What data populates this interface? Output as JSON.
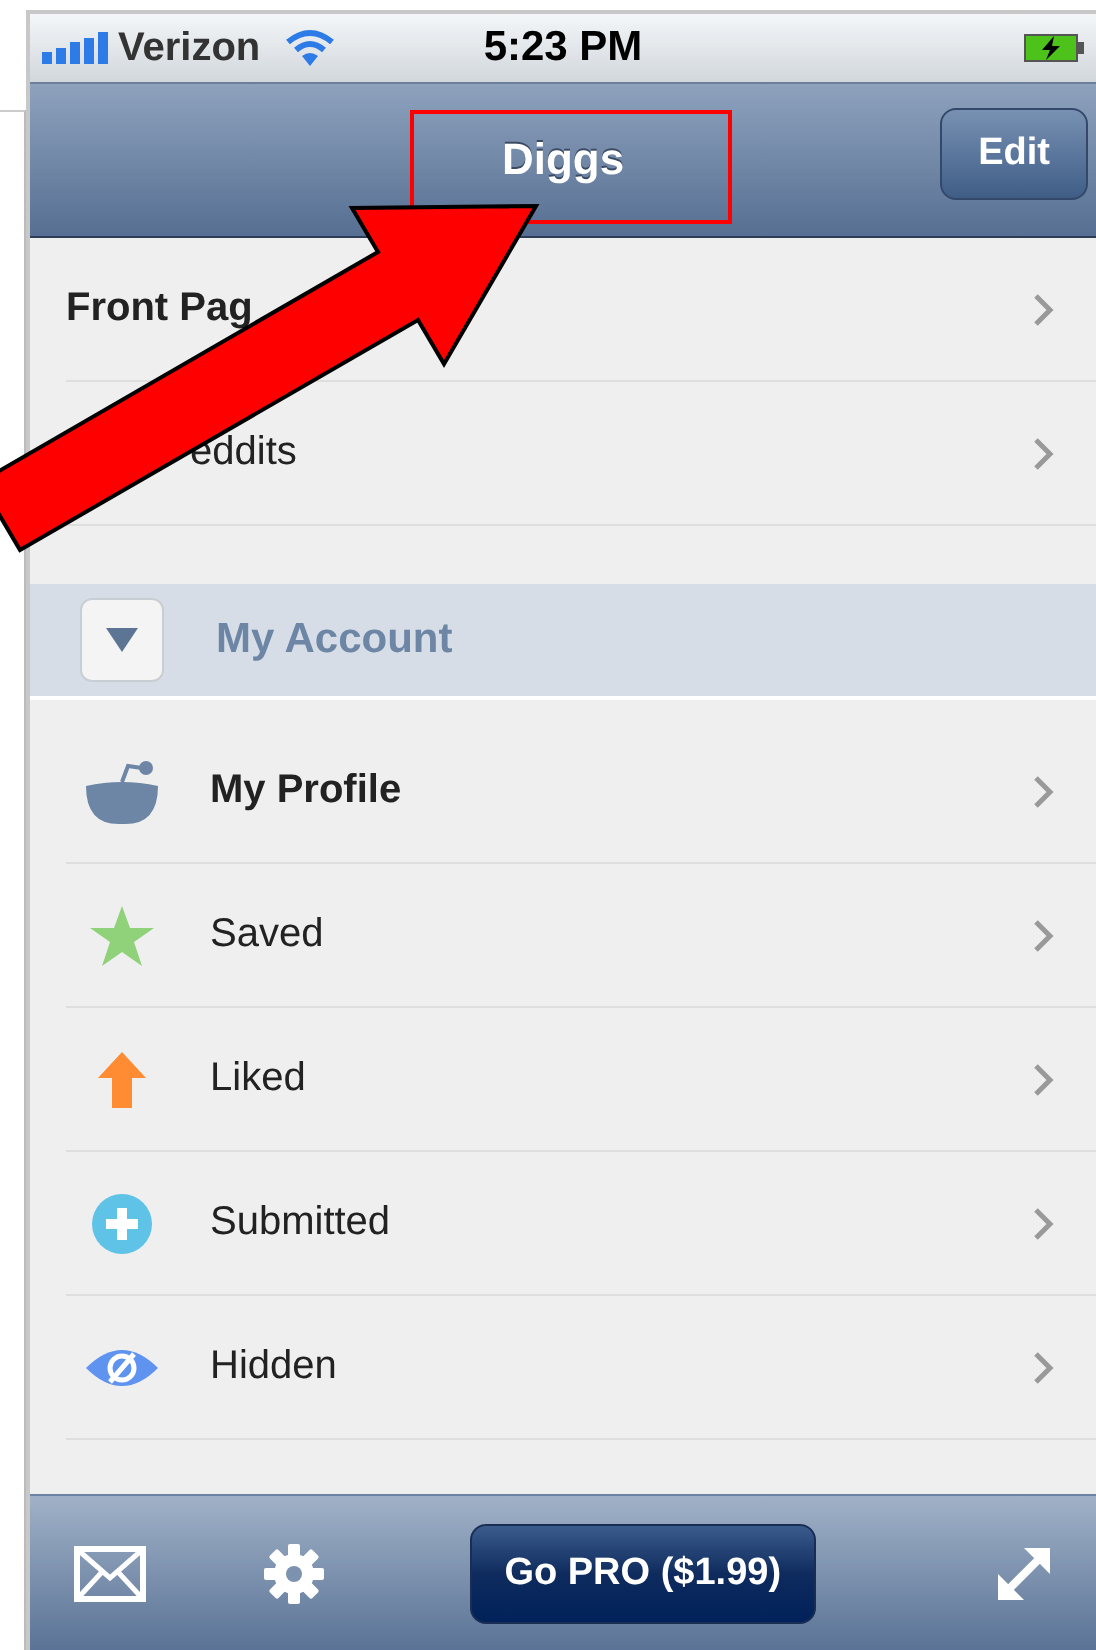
{
  "status_bar": {
    "carrier": "Verizon",
    "time": "5:23 PM"
  },
  "nav": {
    "title": "Diggs",
    "edit": "Edit"
  },
  "top_rows": [
    {
      "label": "Front Pag",
      "emphasized": true
    },
    {
      "label": "eddits",
      "emphasized": false
    }
  ],
  "section": {
    "label": "My Account",
    "expanded": true
  },
  "account_rows": [
    {
      "kind": "profile",
      "label": "My Profile",
      "emphasized": true
    },
    {
      "kind": "saved",
      "label": "Saved",
      "emphasized": false
    },
    {
      "kind": "liked",
      "label": "Liked",
      "emphasized": false
    },
    {
      "kind": "submitted",
      "label": "Submitted",
      "emphasized": false
    },
    {
      "kind": "hidden",
      "label": "Hidden",
      "emphasized": false
    }
  ],
  "toolbar": {
    "pro_button": "Go PRO ($1.99)"
  }
}
